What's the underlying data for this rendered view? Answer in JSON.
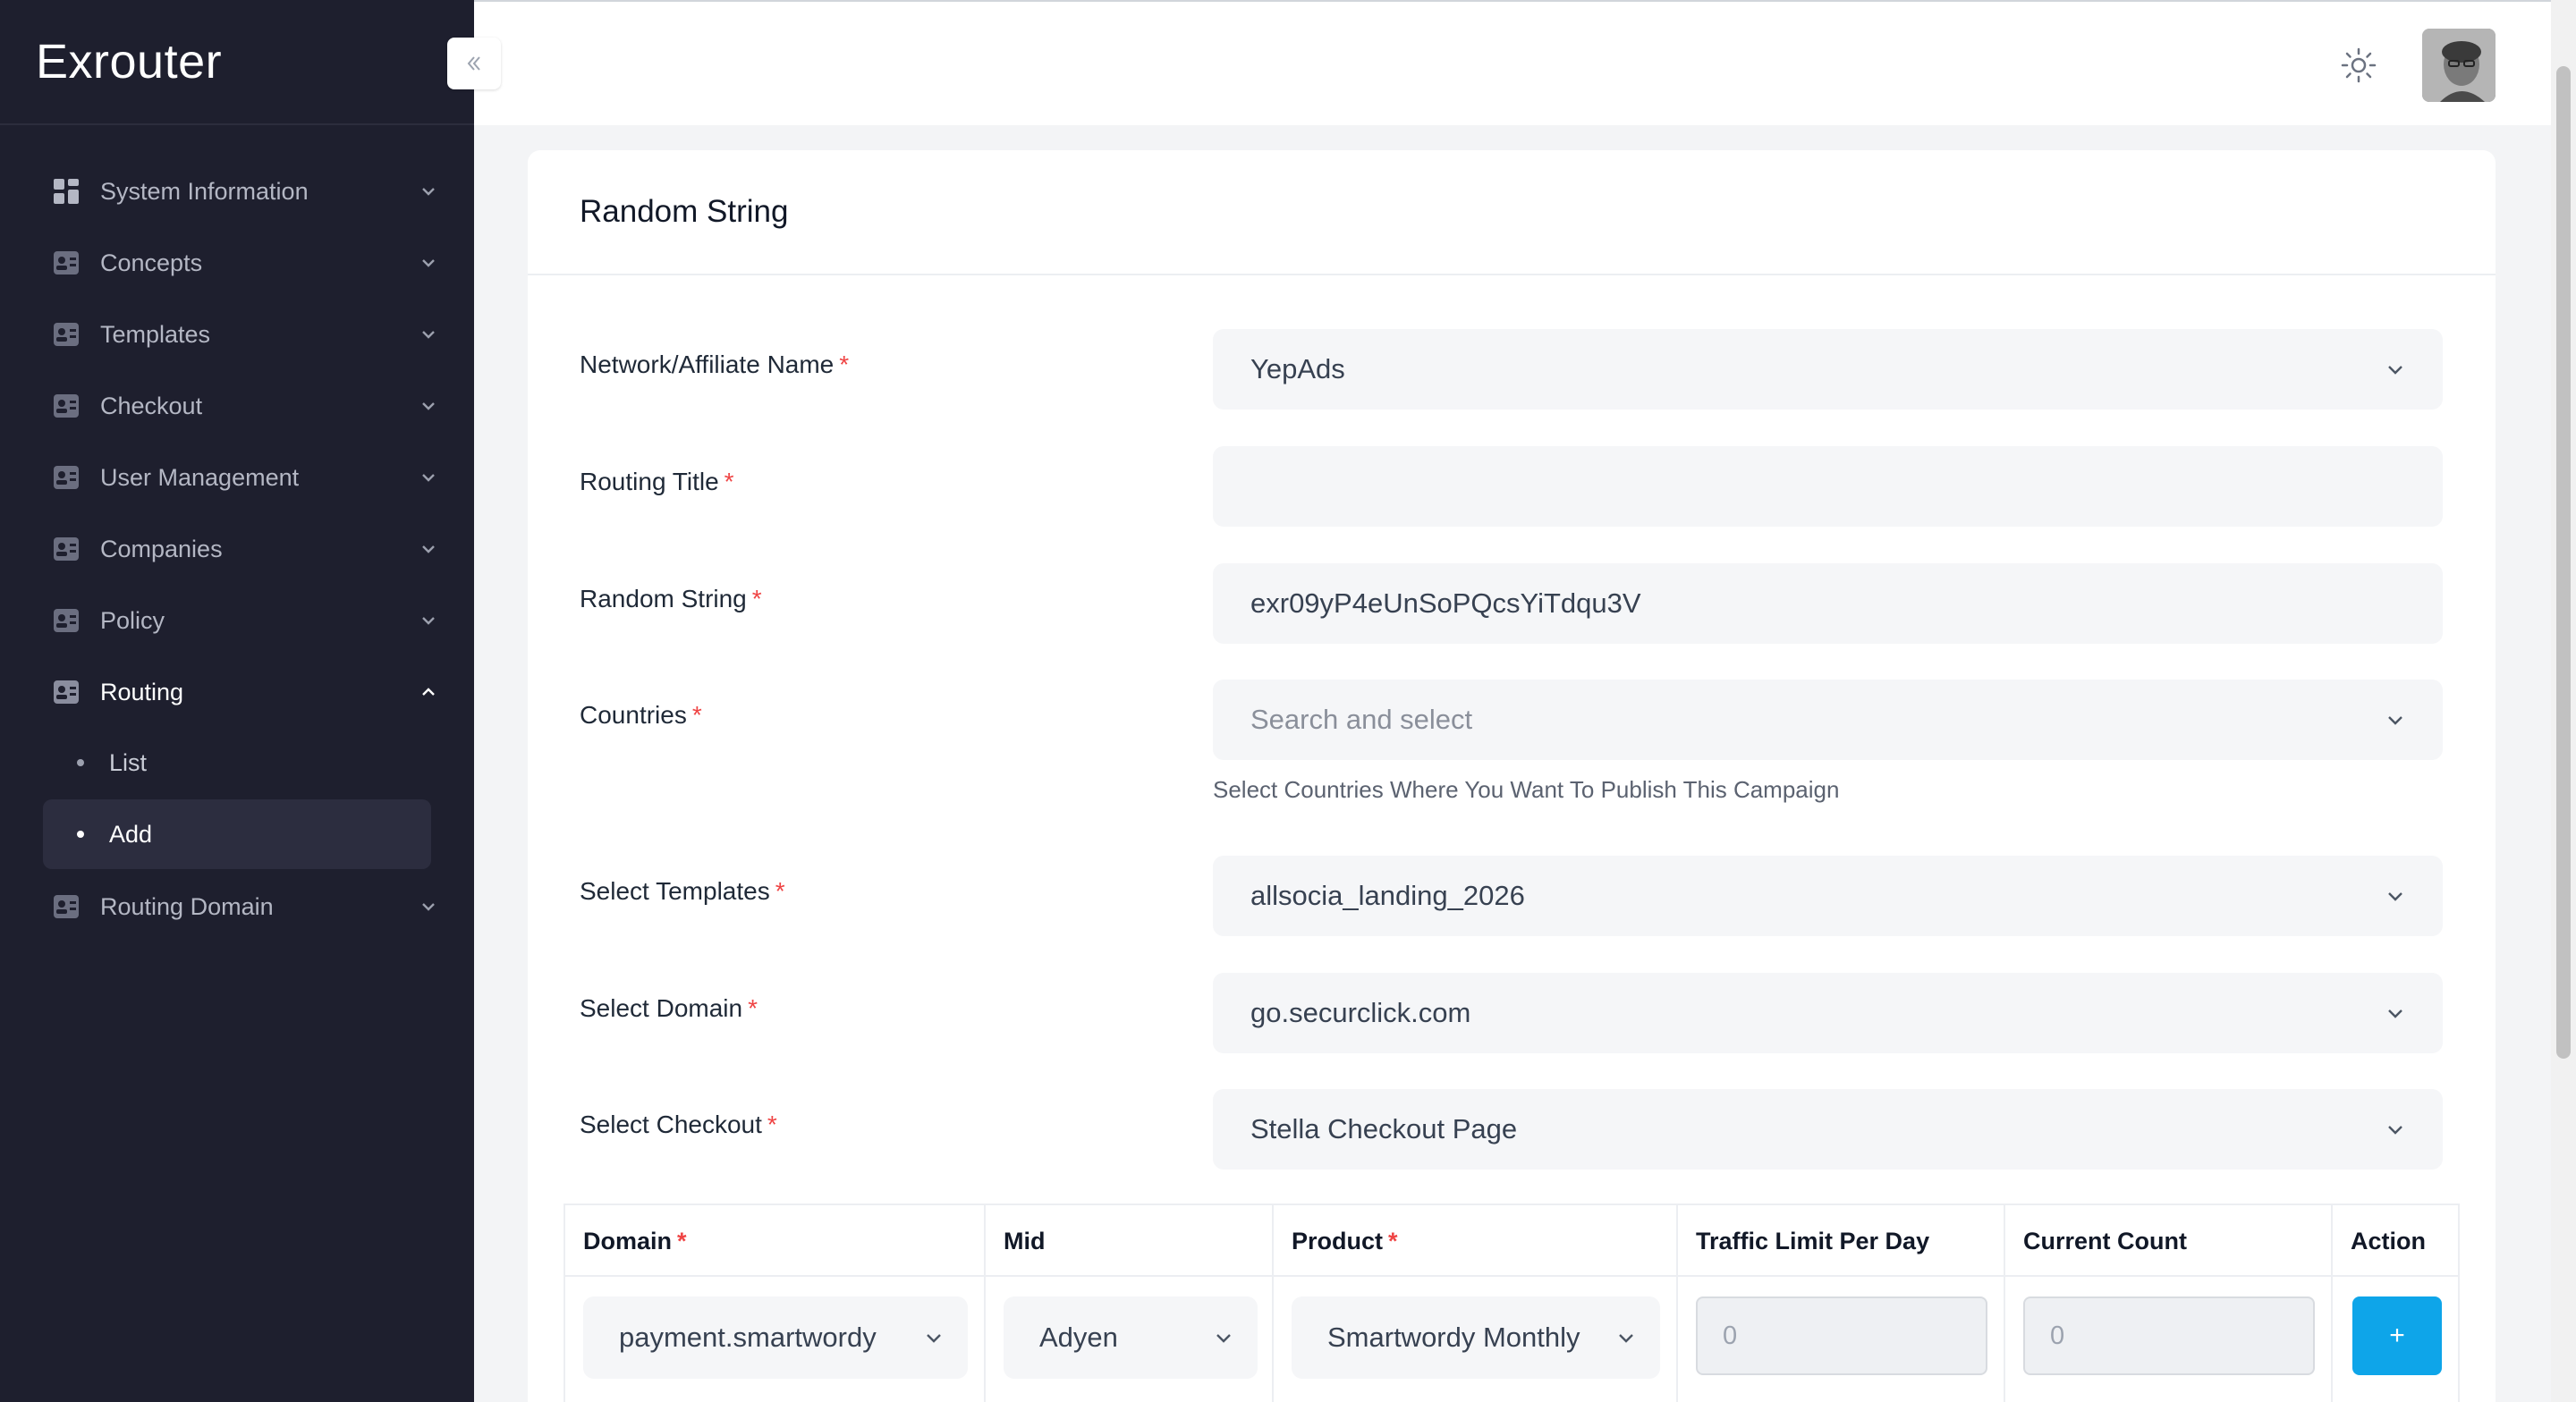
{
  "app": {
    "logo": "Exrouter"
  },
  "sidebar": {
    "items": [
      {
        "label": "System Information",
        "icon": "dashboard-icon"
      },
      {
        "label": "Concepts",
        "icon": "contact-card-icon"
      },
      {
        "label": "Templates",
        "icon": "contact-card-icon"
      },
      {
        "label": "Checkout",
        "icon": "contact-card-icon"
      },
      {
        "label": "User Management",
        "icon": "contact-card-icon"
      },
      {
        "label": "Companies",
        "icon": "contact-card-icon"
      },
      {
        "label": "Policy",
        "icon": "contact-card-icon"
      },
      {
        "label": "Routing",
        "icon": "contact-card-icon",
        "expanded": true
      },
      {
        "label": "Routing Domain",
        "icon": "contact-card-icon"
      }
    ],
    "routing_sub": [
      {
        "label": "List"
      },
      {
        "label": "Add",
        "active": true
      }
    ]
  },
  "header": {
    "theme_icon": "sun-icon",
    "avatar": "user-avatar"
  },
  "card": {
    "title": "Random String",
    "required_mark": "*",
    "fields": {
      "network": {
        "label": "Network/Affiliate Name",
        "value": "YepAds"
      },
      "routing_title": {
        "label": "Routing Title",
        "value": ""
      },
      "random_string": {
        "label": "Random String",
        "value": "exr09yP4eUnSoPQcsYiTdqu3V"
      },
      "countries": {
        "label": "Countries",
        "placeholder": "Search and select",
        "helper": "Select Countries Where You Want To Publish This Campaign"
      },
      "templates": {
        "label": "Select Templates",
        "value": "allsocia_landing_2026"
      },
      "domain": {
        "label": "Select Domain",
        "value": "go.securclick.com"
      },
      "checkout": {
        "label": "Select Checkout",
        "value": "Stella Checkout Page"
      }
    },
    "table": {
      "headers": {
        "domain": "Domain",
        "mid": "Mid",
        "product": "Product",
        "traffic": "Traffic Limit Per Day",
        "count": "Current Count",
        "action": "Action"
      },
      "row": {
        "domain": "payment.smartwordy",
        "mid": "Adyen",
        "product": "Smartwordy Monthly",
        "traffic": "0",
        "count": "0",
        "action": "+"
      }
    }
  },
  "colors": {
    "sidebar_bg": "#1e1f2e",
    "accent": "#0ea5e9",
    "required": "#ef4444"
  }
}
